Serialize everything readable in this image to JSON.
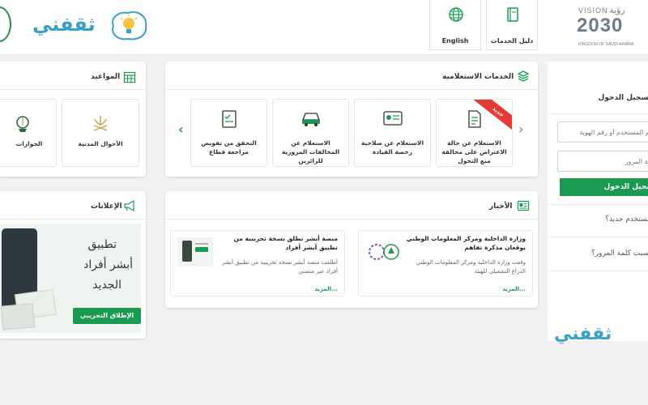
{
  "header": {
    "english_label": "English",
    "guide_label": "دليل الخدمات",
    "vision_latin": "VISION",
    "vision_arabic": "رؤية",
    "vision_year": "2030",
    "vision_country": "KINGDOM OF SAUDI ARABIA",
    "brand_wordmark": "ثقفني"
  },
  "services": {
    "title": "الخدمات الاستعلامية",
    "new_badge": "جديد",
    "cards": [
      {
        "label": "الاستعلام عن حالة الاعتراض على مخالفة منع التجول"
      },
      {
        "label": "الاستعلام عن صلاحية رخصة القيادة"
      },
      {
        "label": "الاستعلام عن المخالفات المرورية للزائرين"
      },
      {
        "label": "التحقق من تفويض مراجعة قطاع"
      }
    ]
  },
  "appointments": {
    "title": "المواعيد",
    "items": [
      {
        "label": "الأحوال المدنية"
      },
      {
        "label": "الجوازات"
      }
    ]
  },
  "news": {
    "title": "الأخبار",
    "items": [
      {
        "title": "وزارة الداخلية ومركز المعلومات الوطني يوقعان مذكرة تفاهم",
        "body": "وقعت وزارة الداخلية ومركز المعلومات الوطني الذراع التشغيلي للهيئة",
        "more": "المزيد..."
      },
      {
        "title": "منصة أبشر تطلق نسخة تجريبية من تطبيق أبشر أفراد",
        "body": "أطلقت منصة أبشر نسخة تجريبية من تطبيق أبشر أفراد عبر منصتي",
        "more": "المزيد..."
      }
    ]
  },
  "ads": {
    "title": "الإعلانات",
    "line1": "تطبيق",
    "line2": "أبشر أفراد",
    "line3": "الجديد",
    "button": "الإطلاق التجريبي"
  },
  "login": {
    "title": "تسجيل الدخول",
    "username_placeholder": "اسم المستخدم أو رقم الهوية",
    "password_placeholder": "كلمة المرور",
    "submit": "تسجيل الدخول",
    "new_user": "مستخدم جديد؟",
    "forgot": "نسيت كلمة المرور؟",
    "brand_wordmark": "ثقفني"
  },
  "colors": {
    "accent_green": "#1a9a50",
    "badge_red": "#e53935",
    "brand_blue": "#3aa0c8"
  }
}
